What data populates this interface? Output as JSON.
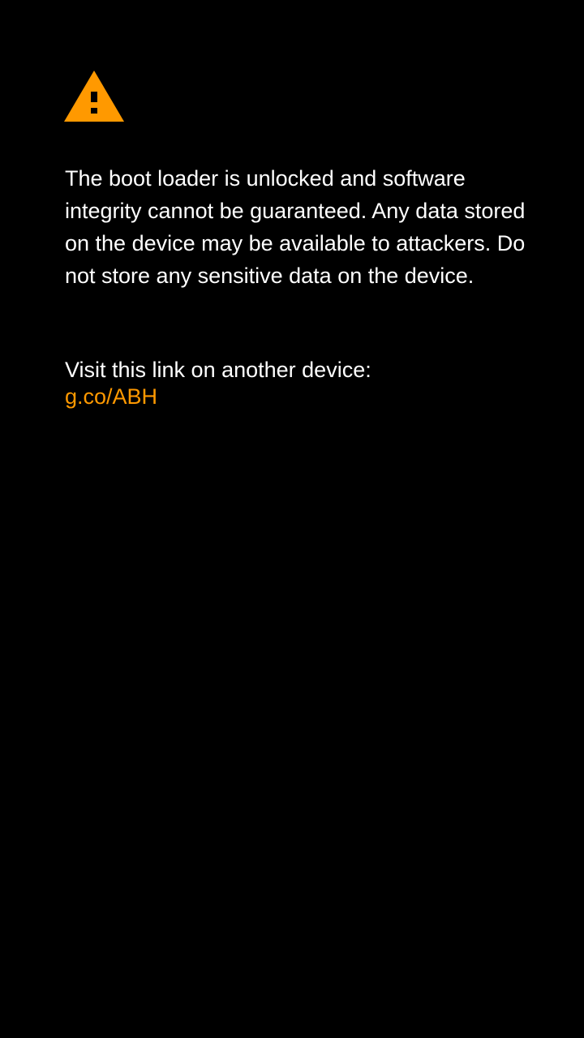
{
  "warning": {
    "icon": "warning-triangle-icon",
    "color": "#ff9900"
  },
  "message": {
    "body": "The boot loader is unlocked and software integrity cannot be guaranteed. Any data stored on the device may be available to attackers. Do not store any sensitive data on the device."
  },
  "visit": {
    "label": "Visit this link on another device:",
    "link": "g.co/ABH",
    "link_color": "#ff9900"
  },
  "colors": {
    "background": "#000000",
    "text": "#ffffff"
  }
}
